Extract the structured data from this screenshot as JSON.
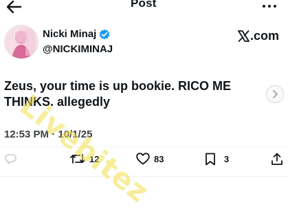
{
  "header": {
    "title": "Post",
    "back_icon": "arrow-left-icon",
    "more_icon": "more-horizontal-icon"
  },
  "author": {
    "name": "Nicki Minaj",
    "handle": "@NICKIMINAJ",
    "verified_icon": "verified-badge-icon",
    "verified_color": "#1d9bf0"
  },
  "source": {
    "brand_text": ".com",
    "brand_icon": "x-logo-icon"
  },
  "post": {
    "text": "Zeus, your time is up bookie. RICO ME THINKS. allegedly",
    "timestamp": "12:53 PM · 10/1/25"
  },
  "actions": {
    "retweets": "12",
    "likes": "83",
    "bookmarks": "3",
    "retweet_icon": "retweet-icon",
    "like_icon": "heart-icon",
    "bookmark_icon": "bookmark-icon",
    "share_icon": "share-icon",
    "reply_icon": "reply-icon"
  },
  "watermark": {
    "text": "Livebitez"
  },
  "colors": {
    "text": "#0f1419",
    "watermark": "#f2e04a"
  }
}
